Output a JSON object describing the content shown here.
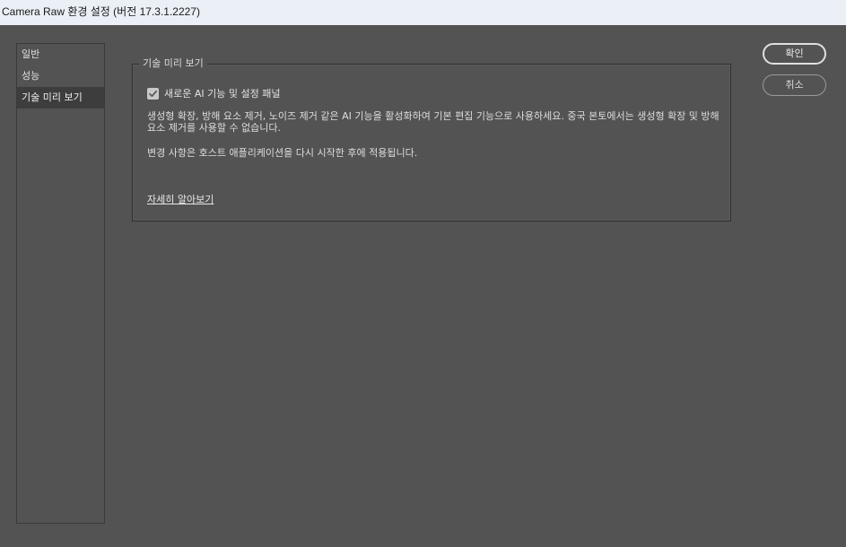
{
  "window": {
    "title": "Camera Raw 환경 설정  (버전 17.3.1.2227)"
  },
  "sidebar": {
    "items": [
      {
        "label": "일반",
        "selected": false
      },
      {
        "label": "성능",
        "selected": false
      },
      {
        "label": "기술 미리 보기",
        "selected": true
      }
    ]
  },
  "panel": {
    "group_title": "기술 미리 보기",
    "checkbox": {
      "label": "새로운 AI 기능 및 설정 패널",
      "checked": true
    },
    "description": "생성형 확장, 방해 요소 제거, 노이즈 제거 같은 AI 기능을 활성화하여 기본 편집 기능으로 사용하세요. 중국 본토에서는 생성형 확장 및 방해 요소 제거를 사용할 수 없습니다.",
    "restart_note": "변경 사항은 호스트 애플리케이션을 다시 시작한 후에 적용됩니다.",
    "learn_more": "자세히 알아보기"
  },
  "buttons": {
    "ok_label": "확인",
    "cancel_label": "취소"
  },
  "colors": {
    "background": "#535353",
    "titlebar": "#eaf0f6",
    "selected_item": "#3d3d3d"
  }
}
